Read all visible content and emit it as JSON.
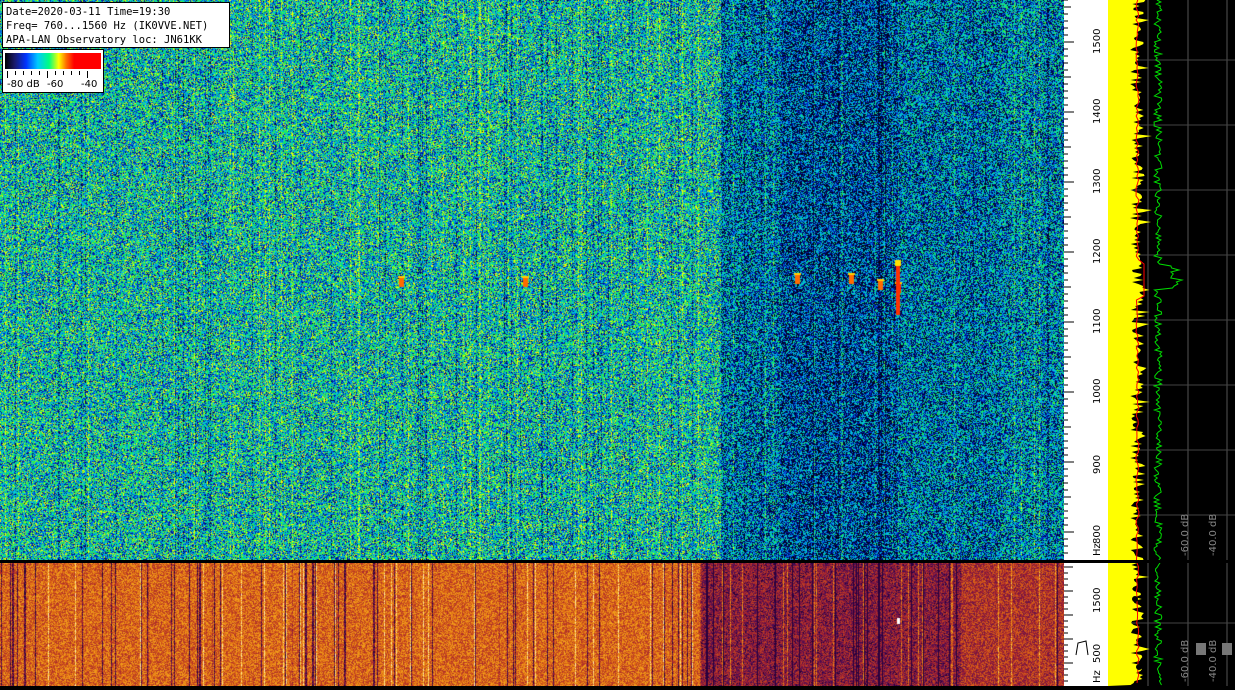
{
  "info": {
    "line1": "Date=2020-03-11 Time=19:30",
    "line2": "Freq= 760...1560 Hz (IK0VVE.NET)",
    "line3": "APA-LAN Observatory loc: JN61KK"
  },
  "colorbar": {
    "labels": [
      "-80 dB",
      "-60",
      "-40"
    ]
  },
  "freq_axis_top": {
    "unit": "Hz",
    "ticks": [
      "1500",
      "1400",
      "1300",
      "1200",
      "1100",
      "1000",
      "900",
      "800"
    ]
  },
  "freq_axis_bottom": {
    "unit": "Hz",
    "ticks": [
      "1500",
      "500"
    ]
  },
  "spectrum_top": {
    "db_labels": [
      "-60.0 dB",
      "-40.0 dB"
    ]
  },
  "spectrum_bottom": {
    "db_labels": [
      "-60.0 dB",
      "-40.0 dB"
    ]
  },
  "colors": {
    "axis_bg": "#ffffff",
    "spectrum_yellow": "#ffff00",
    "spectrum_green": "#00dd00",
    "average_red": "#ff0000"
  }
}
